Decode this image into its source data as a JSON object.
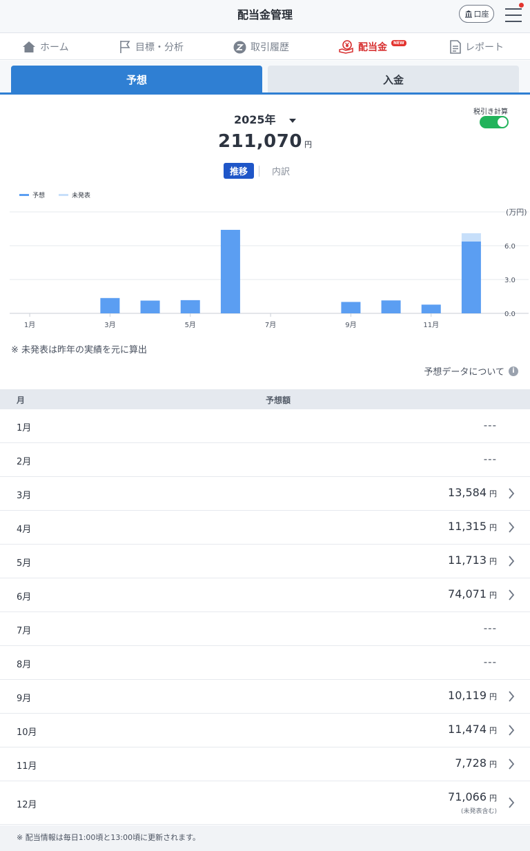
{
  "header": {
    "title": "配当金管理",
    "account_label": "口座"
  },
  "nav": {
    "items": [
      {
        "label": "ホーム",
        "icon": "home-icon"
      },
      {
        "label": "目標・分析",
        "icon": "flag-icon"
      },
      {
        "label": "取引履歴",
        "icon": "history-icon"
      },
      {
        "label": "配当金",
        "icon": "yen-hand-icon",
        "badge": "NEW"
      },
      {
        "label": "レポート",
        "icon": "report-icon"
      }
    ]
  },
  "tabs": {
    "forecast": "予想",
    "deposit": "入金"
  },
  "summary": {
    "year": "2025年",
    "total": "211,070",
    "unit": "円",
    "tax_label": "税引き計算",
    "tax_enabled": true
  },
  "view_toggle": {
    "active": "推移",
    "other": "内訳"
  },
  "legend": {
    "forecast": "予想",
    "unannounced": "未発表"
  },
  "chart_data": {
    "type": "bar",
    "stacked": true,
    "categories": [
      "1月",
      "2月",
      "3月",
      "4月",
      "5月",
      "6月",
      "7月",
      "8月",
      "9月",
      "10月",
      "11月",
      "12月"
    ],
    "tick_labels": [
      "1月",
      "3月",
      "5月",
      "7月",
      "9月",
      "11月"
    ],
    "series": [
      {
        "name": "予想",
        "color": "#5b9ef2",
        "values": [
          0,
          0,
          1.3584,
          1.1315,
          1.1713,
          7.4071,
          0,
          0,
          1.0119,
          1.1474,
          0.7728,
          6.38
        ]
      },
      {
        "name": "未発表",
        "color": "#c7dffa",
        "values": [
          0,
          0,
          0,
          0,
          0,
          0,
          0,
          0,
          0,
          0,
          0,
          0.7266
        ]
      }
    ],
    "y_unit": "(万円)",
    "y_ticks": [
      "0.0",
      "3.0",
      "6.0"
    ],
    "ylim": [
      0,
      9
    ],
    "grid": true,
    "legend_position": "top-left"
  },
  "note": "※ 未発表は昨年の実績を元に算出",
  "about_label": "予想データについて",
  "table": {
    "headers": {
      "month": "月",
      "amount": "予想額"
    },
    "rows": [
      {
        "month": "1月",
        "amount": "---"
      },
      {
        "month": "2月",
        "amount": "---"
      },
      {
        "month": "3月",
        "amount": "13,584",
        "unit": "円"
      },
      {
        "month": "4月",
        "amount": "11,315",
        "unit": "円"
      },
      {
        "month": "5月",
        "amount": "11,713",
        "unit": "円"
      },
      {
        "month": "6月",
        "amount": "74,071",
        "unit": "円"
      },
      {
        "month": "7月",
        "amount": "---"
      },
      {
        "month": "8月",
        "amount": "---"
      },
      {
        "month": "9月",
        "amount": "10,119",
        "unit": "円"
      },
      {
        "month": "10月",
        "amount": "11,474",
        "unit": "円"
      },
      {
        "month": "11月",
        "amount": "7,728",
        "unit": "円"
      },
      {
        "month": "12月",
        "amount": "71,066",
        "unit": "円",
        "sub": "(未発表含む)"
      }
    ]
  },
  "footer_note": "※ 配当情報は毎日1:00頃と13:00頃に更新されます。",
  "colors": {
    "accent": "#2f7fd3",
    "active_nav": "#d72f2f",
    "toggle_on": "#22b35b",
    "bar": "#5b9ef2",
    "bar_light": "#c7dffa"
  }
}
